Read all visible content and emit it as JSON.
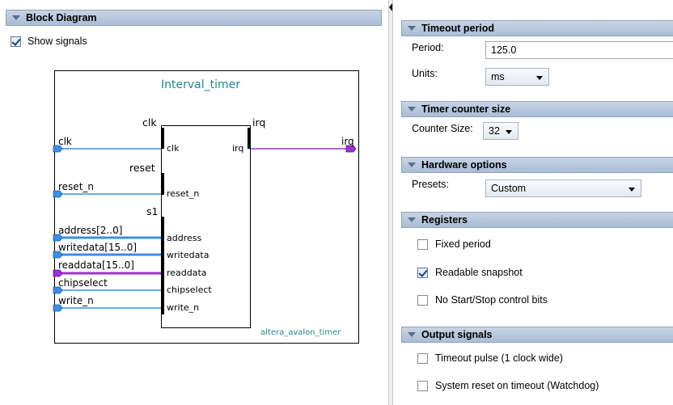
{
  "block_diagram": {
    "header": "Block Diagram",
    "show_signals_label": "Show signals",
    "show_signals_checked": true,
    "component_name": "Interval_timer",
    "component_type": "altera_avalon_timer",
    "interfaces": {
      "clk": "clk",
      "reset": "reset",
      "s1": "s1",
      "irq": "irq"
    },
    "ports": {
      "clk": "clk",
      "irq": "irq",
      "reset_n": "reset_n",
      "address": "address",
      "writedata": "writedata",
      "readdata": "readdata",
      "chipselect": "chipselect",
      "write_n": "write_n"
    },
    "signals": {
      "clk": "clk",
      "irq": "irq",
      "reset_n": "reset_n",
      "address": "address[2..0]",
      "writedata": "writedata[15..0]",
      "readdata": "readdata[15..0]",
      "chipselect": "chipselect",
      "write_n": "write_n"
    },
    "colors": {
      "clock_wire": "#3a8ee6",
      "irq_wire": "#9b30d9",
      "conduit_wire": "#3a8ee6",
      "readdata_wire": "#9b30d9",
      "title_text": "#1f8a8a"
    }
  },
  "timeout_period": {
    "header": "Timeout period",
    "period_label": "Period:",
    "period_value": "125.0",
    "units_label": "Units:",
    "units_value": "ms"
  },
  "timer_counter_size": {
    "header": "Timer counter size",
    "counter_size_label": "Counter Size:",
    "counter_size_value": "32"
  },
  "hardware_options": {
    "header": "Hardware options",
    "presets_label": "Presets:",
    "presets_value": "Custom"
  },
  "registers": {
    "header": "Registers",
    "fixed_period_label": "Fixed period",
    "fixed_period_checked": false,
    "readable_snapshot_label": "Readable snapshot",
    "readable_snapshot_checked": true,
    "no_start_stop_label": "No Start/Stop control bits",
    "no_start_stop_checked": false
  },
  "output_signals": {
    "header": "Output signals",
    "timeout_pulse_label": "Timeout pulse (1 clock wide)",
    "timeout_pulse_checked": false,
    "system_reset_label": "System reset on timeout (Watchdog)",
    "system_reset_checked": false
  }
}
